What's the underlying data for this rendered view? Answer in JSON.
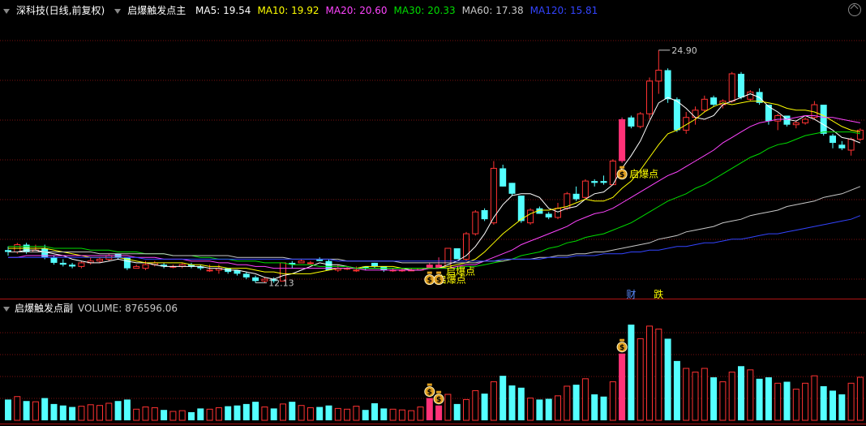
{
  "header": {
    "stock": "深科技(日线,前复权)",
    "indicator": "启爆触发点主",
    "ma": [
      {
        "label": "MA5: 19.54",
        "color": "#ffffff"
      },
      {
        "label": "MA10: 19.92",
        "color": "#ffff00"
      },
      {
        "label": "MA20: 20.60",
        "color": "#ff44ff"
      },
      {
        "label": "MA30: 20.33",
        "color": "#00dd00"
      },
      {
        "label": "MA60: 17.38",
        "color": "#c8c8c8"
      },
      {
        "label": "MA120: 15.81",
        "color": "#3344ff"
      }
    ]
  },
  "volume_header": {
    "indicator": "启爆触发点副",
    "volume": "VOLUME: 876596.06"
  },
  "chart_data": {
    "type": "candlestick",
    "price_range": [
      11.5,
      26.5
    ],
    "volume_range": [
      0,
      1400000
    ],
    "up_color": "#ff3232",
    "down_color": "#54ffff",
    "signal_color": "#ff3278",
    "candles": [
      [
        13.9,
        14.1,
        13.6,
        13.8,
        280000
      ],
      [
        13.8,
        14.3,
        13.7,
        14.2,
        320000
      ],
      [
        14.2,
        14.3,
        13.7,
        13.8,
        260000
      ],
      [
        13.8,
        14.2,
        13.8,
        13.9,
        250000
      ],
      [
        14.0,
        14.2,
        13.4,
        13.5,
        300000
      ],
      [
        13.5,
        13.6,
        13.1,
        13.2,
        220000
      ],
      [
        13.2,
        13.4,
        13.0,
        13.1,
        200000
      ],
      [
        13.1,
        13.2,
        12.9,
        13.0,
        180000
      ],
      [
        13.0,
        13.3,
        12.9,
        13.2,
        190000
      ],
      [
        13.2,
        13.5,
        13.1,
        13.3,
        210000
      ],
      [
        13.3,
        13.5,
        13.2,
        13.4,
        200000
      ],
      [
        13.4,
        13.7,
        13.3,
        13.6,
        230000
      ],
      [
        13.7,
        13.7,
        13.4,
        13.5,
        260000
      ],
      [
        13.5,
        13.5,
        12.8,
        12.9,
        280000
      ],
      [
        12.9,
        13.1,
        12.9,
        13.0,
        150000
      ],
      [
        12.9,
        13.3,
        12.8,
        13.1,
        180000
      ],
      [
        13.1,
        13.3,
        13.0,
        13.2,
        170000
      ],
      [
        13.1,
        13.2,
        12.9,
        13.0,
        140000
      ],
      [
        13.0,
        13.1,
        12.9,
        13.0,
        120000
      ],
      [
        13.0,
        13.2,
        12.9,
        13.1,
        130000
      ],
      [
        13.1,
        13.2,
        12.9,
        13.0,
        110000
      ],
      [
        13.0,
        13.1,
        12.8,
        12.9,
        160000
      ],
      [
        12.8,
        13.1,
        12.7,
        12.8,
        150000
      ],
      [
        12.8,
        13.1,
        12.6,
        12.9,
        170000
      ],
      [
        12.9,
        12.9,
        12.6,
        12.7,
        190000
      ],
      [
        12.8,
        12.8,
        12.5,
        12.6,
        200000
      ],
      [
        12.6,
        12.7,
        12.3,
        12.4,
        220000
      ],
      [
        12.4,
        12.5,
        12.1,
        12.2,
        250000
      ],
      [
        12.2,
        12.4,
        12.1,
        12.3,
        180000
      ],
      [
        12.3,
        12.4,
        12.1,
        12.2,
        160000
      ],
      [
        12.2,
        13.2,
        12.2,
        13.2,
        220000
      ],
      [
        13.2,
        13.3,
        12.9,
        13.1,
        250000
      ],
      [
        13.2,
        13.4,
        13.2,
        13.3,
        200000
      ],
      [
        13.2,
        13.3,
        13.1,
        13.2,
        170000
      ],
      [
        13.4,
        13.5,
        13.3,
        13.3,
        180000
      ],
      [
        13.3,
        13.4,
        12.8,
        12.8,
        200000
      ],
      [
        12.8,
        13.1,
        12.7,
        12.9,
        160000
      ],
      [
        12.9,
        13.0,
        12.8,
        12.9,
        150000
      ],
      [
        12.8,
        13.0,
        12.7,
        12.8,
        190000
      ],
      [
        13.0,
        13.0,
        12.8,
        12.9,
        140000
      ],
      [
        13.2,
        13.2,
        12.9,
        13.0,
        230000
      ],
      [
        13.0,
        13.0,
        12.7,
        12.8,
        160000
      ],
      [
        12.8,
        12.9,
        12.7,
        12.8,
        150000
      ],
      [
        12.8,
        12.9,
        12.7,
        12.8,
        140000
      ],
      [
        12.8,
        12.9,
        12.8,
        12.8,
        130000
      ],
      [
        12.8,
        12.9,
        12.8,
        12.9,
        180000
      ],
      [
        12.9,
        13.2,
        12.9,
        13.1,
        300000
      ],
      [
        13.1,
        13.5,
        12.9,
        12.9,
        200000
      ],
      [
        12.9,
        14.0,
        12.9,
        14.0,
        350000
      ],
      [
        14.0,
        14.0,
        13.4,
        13.4,
        220000
      ],
      [
        13.4,
        14.9,
        13.3,
        14.8,
        280000
      ],
      [
        14.8,
        16.1,
        14.7,
        16.0,
        400000
      ],
      [
        16.1,
        16.2,
        15.5,
        15.6,
        360000
      ],
      [
        15.4,
        18.8,
        15.3,
        18.4,
        520000
      ],
      [
        18.4,
        18.6,
        17.4,
        17.4,
        600000
      ],
      [
        17.6,
        17.6,
        16.9,
        17.0,
        470000
      ],
      [
        16.9,
        16.9,
        15.4,
        15.5,
        440000
      ],
      [
        15.4,
        16.2,
        15.3,
        16.1,
        300000
      ],
      [
        16.2,
        16.3,
        15.9,
        15.9,
        280000
      ],
      [
        15.9,
        16.0,
        15.6,
        15.7,
        290000
      ],
      [
        15.7,
        16.5,
        15.6,
        16.2,
        330000
      ],
      [
        16.2,
        17.1,
        16.1,
        17.0,
        460000
      ],
      [
        17.0,
        17.4,
        16.6,
        16.7,
        480000
      ],
      [
        16.8,
        17.8,
        16.7,
        17.7,
        560000
      ],
      [
        17.7,
        17.8,
        17.4,
        17.6,
        350000
      ],
      [
        17.7,
        18.0,
        17.5,
        17.6,
        320000
      ],
      [
        17.5,
        18.9,
        17.5,
        18.8,
        520000
      ],
      [
        18.8,
        21.2,
        18.7,
        21.1,
        900000
      ],
      [
        21.2,
        21.3,
        20.6,
        20.7,
        1290000
      ],
      [
        20.7,
        21.5,
        20.6,
        21.4,
        1100000
      ],
      [
        21.4,
        23.4,
        21.1,
        23.2,
        1270000
      ],
      [
        23.2,
        24.9,
        22.5,
        23.8,
        1230000
      ],
      [
        23.8,
        23.9,
        22.0,
        22.2,
        1100000
      ],
      [
        22.2,
        22.3,
        20.4,
        20.5,
        800000
      ],
      [
        20.5,
        21.5,
        20.3,
        21.2,
        700000
      ],
      [
        21.2,
        21.8,
        20.8,
        21.6,
        650000
      ],
      [
        21.6,
        22.4,
        21.5,
        22.2,
        700000
      ],
      [
        22.3,
        22.4,
        21.8,
        21.9,
        580000
      ],
      [
        21.9,
        22.2,
        21.7,
        22.1,
        520000
      ],
      [
        22.1,
        23.7,
        22.0,
        23.6,
        650000
      ],
      [
        23.6,
        23.7,
        22.2,
        22.3,
        730000
      ],
      [
        22.2,
        22.7,
        22.1,
        22.6,
        680000
      ],
      [
        22.6,
        22.8,
        21.9,
        22.0,
        560000
      ],
      [
        21.9,
        21.9,
        20.8,
        21.0,
        580000
      ],
      [
        21.0,
        21.4,
        20.5,
        21.3,
        500000
      ],
      [
        21.3,
        21.3,
        20.7,
        20.8,
        520000
      ],
      [
        20.8,
        21.0,
        20.6,
        20.9,
        420000
      ],
      [
        20.9,
        21.2,
        20.8,
        21.1,
        500000
      ],
      [
        21.2,
        22.1,
        21.1,
        21.9,
        600000
      ],
      [
        21.9,
        21.9,
        20.2,
        20.3,
        460000
      ],
      [
        20.2,
        20.3,
        19.5,
        19.8,
        400000
      ],
      [
        19.7,
        19.9,
        19.4,
        19.5,
        350000
      ],
      [
        19.4,
        20.1,
        19.1,
        20.0,
        500000
      ],
      [
        20.0,
        20.6,
        19.9,
        20.5,
        580000
      ],
      [
        20.5,
        20.5,
        19.9,
        20.1,
        460000
      ]
    ],
    "ma_order": [
      "MA5",
      "MA10",
      "MA20",
      "MA30",
      "MA60",
      "MA120"
    ],
    "ma_lines": {
      "MA5": [
        13.8,
        13.8,
        13.9,
        13.9,
        13.8,
        13.7,
        13.6,
        13.4,
        13.3,
        13.2,
        13.2,
        13.3,
        13.4,
        13.3,
        13.2,
        13.2,
        13.1,
        13.0,
        13.0,
        13.0,
        13.0,
        13.0,
        12.9,
        12.9,
        12.8,
        12.8,
        12.7,
        12.6,
        12.4,
        12.3,
        12.5,
        12.6,
        12.8,
        13.0,
        13.2,
        13.1,
        13.1,
        13.0,
        12.9,
        12.9,
        12.9,
        12.9,
        12.9,
        12.9,
        12.8,
        12.8,
        12.9,
        12.9,
        13.1,
        13.3,
        13.6,
        14.1,
        14.8,
        15.7,
        16.4,
        16.9,
        17.0,
        17.0,
        16.8,
        16.2,
        16.0,
        16.2,
        16.3,
        16.7,
        17.0,
        17.1,
        17.5,
        18.4,
        19.1,
        19.9,
        21.0,
        22.0,
        22.3,
        22.1,
        21.7,
        21.2,
        21.1,
        21.3,
        21.9,
        22.1,
        22.3,
        22.5,
        22.3,
        21.8,
        21.5,
        21.1,
        21.0,
        21.3,
        21.1,
        20.8,
        20.5,
        20.1,
        20.0,
        19.8
      ],
      "MA10": [
        14.0,
        14.0,
        14.0,
        14.0,
        14.0,
        13.9,
        13.8,
        13.7,
        13.6,
        13.5,
        13.5,
        13.5,
        13.5,
        13.4,
        13.3,
        13.2,
        13.2,
        13.2,
        13.2,
        13.2,
        13.1,
        13.1,
        13.0,
        13.0,
        12.9,
        12.9,
        12.9,
        12.8,
        12.7,
        12.7,
        12.6,
        12.6,
        12.6,
        12.6,
        12.7,
        12.8,
        12.9,
        12.9,
        12.9,
        13.0,
        13.0,
        13.0,
        13.0,
        12.9,
        12.9,
        12.9,
        12.9,
        12.9,
        13.0,
        13.1,
        13.2,
        13.4,
        13.8,
        14.3,
        14.8,
        15.2,
        15.6,
        15.9,
        16.1,
        16.1,
        16.2,
        16.3,
        16.5,
        16.7,
        16.6,
        16.6,
        16.8,
        17.3,
        17.7,
        18.3,
        19.0,
        19.7,
        20.3,
        20.5,
        20.8,
        21.1,
        21.5,
        21.8,
        22.0,
        21.9,
        22.0,
        22.1,
        22.1,
        22.0,
        21.9,
        21.7,
        21.6,
        21.6,
        21.5,
        21.3,
        21.0,
        20.7,
        20.5,
        20.4
      ],
      "MA20": [
        13.5,
        13.5,
        13.6,
        13.6,
        13.6,
        13.6,
        13.6,
        13.6,
        13.6,
        13.6,
        13.6,
        13.6,
        13.6,
        13.6,
        13.5,
        13.5,
        13.5,
        13.4,
        13.4,
        13.4,
        13.3,
        13.3,
        13.3,
        13.2,
        13.2,
        13.1,
        13.1,
        13.0,
        13.0,
        12.9,
        12.9,
        12.9,
        12.9,
        12.9,
        12.9,
        12.9,
        12.9,
        12.9,
        12.9,
        12.8,
        12.8,
        12.8,
        12.8,
        12.8,
        12.8,
        12.8,
        12.9,
        12.9,
        12.9,
        13.0,
        13.1,
        13.1,
        13.3,
        13.5,
        13.7,
        13.9,
        14.2,
        14.4,
        14.6,
        14.8,
        15.0,
        15.2,
        15.5,
        15.7,
        15.9,
        16.0,
        16.2,
        16.5,
        16.8,
        17.1,
        17.4,
        17.7,
        18.0,
        18.2,
        18.5,
        18.8,
        19.1,
        19.4,
        19.8,
        20.1,
        20.4,
        20.7,
        20.9,
        21.0,
        21.1,
        21.1,
        21.2,
        21.3,
        21.3,
        21.2,
        21.2,
        21.1,
        21.0,
        20.9
      ],
      "MA30": [
        14.1,
        14.1,
        14.1,
        14.1,
        14.1,
        14.0,
        14.0,
        14.0,
        14.0,
        13.9,
        13.9,
        13.9,
        13.8,
        13.8,
        13.8,
        13.7,
        13.7,
        13.7,
        13.6,
        13.6,
        13.6,
        13.5,
        13.5,
        13.4,
        13.4,
        13.3,
        13.3,
        13.3,
        13.2,
        13.2,
        13.2,
        13.1,
        13.1,
        13.1,
        13.0,
        13.0,
        13.0,
        13.0,
        12.9,
        12.9,
        12.9,
        12.9,
        12.9,
        12.9,
        12.9,
        12.9,
        12.9,
        12.9,
        12.9,
        12.9,
        13.0,
        13.0,
        13.1,
        13.2,
        13.3,
        13.4,
        13.6,
        13.7,
        13.8,
        14.0,
        14.1,
        14.3,
        14.4,
        14.6,
        14.7,
        14.8,
        15.0,
        15.2,
        15.4,
        15.7,
        16.0,
        16.3,
        16.6,
        16.8,
        17.0,
        17.3,
        17.5,
        17.8,
        18.1,
        18.4,
        18.7,
        19.0,
        19.2,
        19.5,
        19.7,
        19.8,
        20.0,
        20.2,
        20.3,
        20.4,
        20.4,
        20.4,
        20.4,
        20.3
      ],
      "MA60": [
        13.8,
        13.8,
        13.8,
        13.8,
        13.8,
        13.8,
        13.8,
        13.8,
        13.8,
        13.8,
        13.7,
        13.7,
        13.7,
        13.7,
        13.7,
        13.7,
        13.7,
        13.7,
        13.6,
        13.6,
        13.6,
        13.6,
        13.6,
        13.6,
        13.6,
        13.5,
        13.5,
        13.5,
        13.5,
        13.5,
        13.5,
        13.4,
        13.4,
        13.4,
        13.4,
        13.4,
        13.4,
        13.3,
        13.3,
        13.3,
        13.3,
        13.3,
        13.3,
        13.2,
        13.2,
        13.2,
        13.2,
        13.2,
        13.2,
        13.2,
        13.2,
        13.2,
        13.3,
        13.3,
        13.3,
        13.4,
        13.4,
        13.4,
        13.5,
        13.5,
        13.6,
        13.6,
        13.7,
        13.7,
        13.8,
        13.8,
        13.9,
        14.0,
        14.1,
        14.2,
        14.3,
        14.5,
        14.6,
        14.7,
        14.9,
        15.0,
        15.1,
        15.2,
        15.4,
        15.5,
        15.6,
        15.8,
        15.9,
        16.0,
        16.1,
        16.3,
        16.4,
        16.5,
        16.6,
        16.8,
        16.9,
        17.0,
        17.2,
        17.4
      ],
      "MA120": [
        13.5,
        13.5,
        13.5,
        13.5,
        13.5,
        13.5,
        13.5,
        13.5,
        13.5,
        13.5,
        13.5,
        13.5,
        13.5,
        13.5,
        13.5,
        13.4,
        13.4,
        13.4,
        13.4,
        13.4,
        13.4,
        13.4,
        13.4,
        13.4,
        13.4,
        13.4,
        13.4,
        13.4,
        13.4,
        13.4,
        13.4,
        13.4,
        13.4,
        13.4,
        13.4,
        13.4,
        13.3,
        13.3,
        13.3,
        13.3,
        13.3,
        13.3,
        13.3,
        13.3,
        13.3,
        13.3,
        13.3,
        13.3,
        13.3,
        13.3,
        13.3,
        13.3,
        13.3,
        13.3,
        13.4,
        13.4,
        13.4,
        13.4,
        13.4,
        13.5,
        13.5,
        13.5,
        13.6,
        13.6,
        13.6,
        13.7,
        13.7,
        13.7,
        13.8,
        13.8,
        13.9,
        13.9,
        14.0,
        14.1,
        14.1,
        14.2,
        14.3,
        14.3,
        14.4,
        14.5,
        14.5,
        14.6,
        14.7,
        14.8,
        14.8,
        14.9,
        15.0,
        15.1,
        15.2,
        15.3,
        15.4,
        15.5,
        15.6,
        15.8
      ]
    },
    "signals": [
      {
        "index": 46,
        "label": "启爆点",
        "icon": "money-bag"
      },
      {
        "index": 47,
        "label": "启爆点",
        "icon": "money-bag"
      },
      {
        "index": 67,
        "label": "启爆点",
        "icon": "money-bag"
      }
    ],
    "annotations": [
      {
        "text": "24.90",
        "index": 71,
        "price": 24.9
      },
      {
        "text": "12.13",
        "index": 27,
        "price": 12.1
      }
    ],
    "event_markers": [
      {
        "text": "财",
        "index": 68,
        "color": "#5a8cff"
      },
      {
        "text": "跌",
        "index": 71,
        "color": "#ffff00"
      }
    ]
  }
}
